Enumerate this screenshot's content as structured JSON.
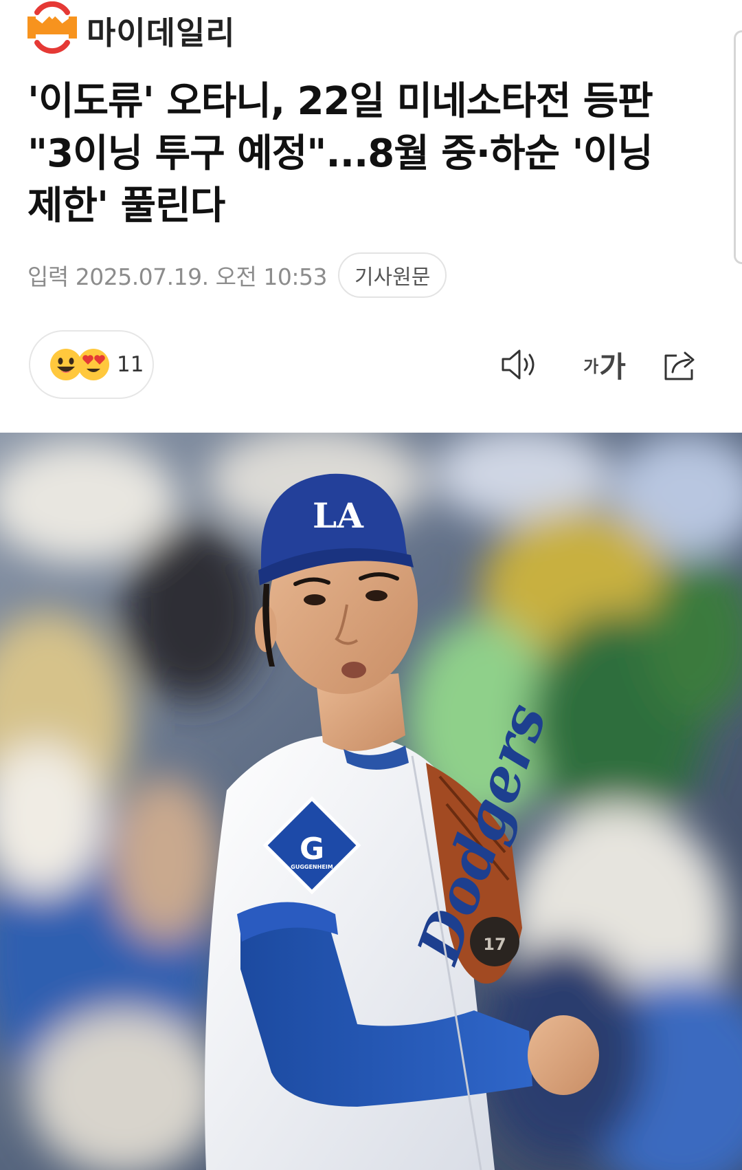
{
  "brand": {
    "name": "마이데일리",
    "logo_icon": "mydaily-logo-icon"
  },
  "article": {
    "headline": "'이도류' 오타니, 22일 미네소타전 등판 \"3이닝 투구 예정\"...8월 중·하순 '이닝 제한' 풀린다",
    "published": "입력 2025.07.19. 오전 10:53",
    "original_button": "기사원문"
  },
  "reactions": {
    "icons": [
      "smile-emoji-icon",
      "heart-eyes-emoji-icon"
    ],
    "count": "11"
  },
  "toolbar": {
    "tts_icon": "speaker-icon",
    "font_small": "가",
    "font_big": "가",
    "share_icon": "share-icon"
  },
  "photo": {
    "cap_logo": "LA",
    "sleeve_patch": "G",
    "sleeve_patch_sub": "GUGGENHEIM",
    "jersey_script": "Dodgers",
    "glove_number": "17"
  },
  "colors": {
    "logo_orange": "#f7931e",
    "logo_red": "#e53935",
    "dodger_blue": "#1f4e9e",
    "meta_gray": "#8c8c8c"
  }
}
